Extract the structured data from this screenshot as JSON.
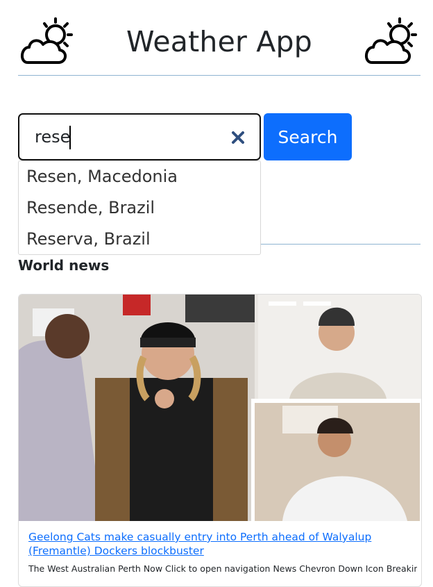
{
  "header": {
    "title": "Weather App",
    "logo_icon": "partly-cloudy-icon"
  },
  "search": {
    "value": "rese",
    "placeholder": "",
    "clear_icon": "close-icon",
    "button_label": "Search"
  },
  "suggestions": [
    "Resen, Macedonia",
    "Resende, Brazil",
    "Reserva, Brazil"
  ],
  "news": {
    "section_title": "World news",
    "articles": [
      {
        "title": "Geelong Cats make casually entry into Perth ahead of Walyalup (Fremantle) Dockers blockbuster",
        "description": "The West Australian Perth Now Click to open navigation  News Chevron Down Icon Breaking"
      }
    ]
  },
  "colors": {
    "accent": "#0d6efd",
    "divider": "#8fb3d1",
    "text": "#212529"
  }
}
